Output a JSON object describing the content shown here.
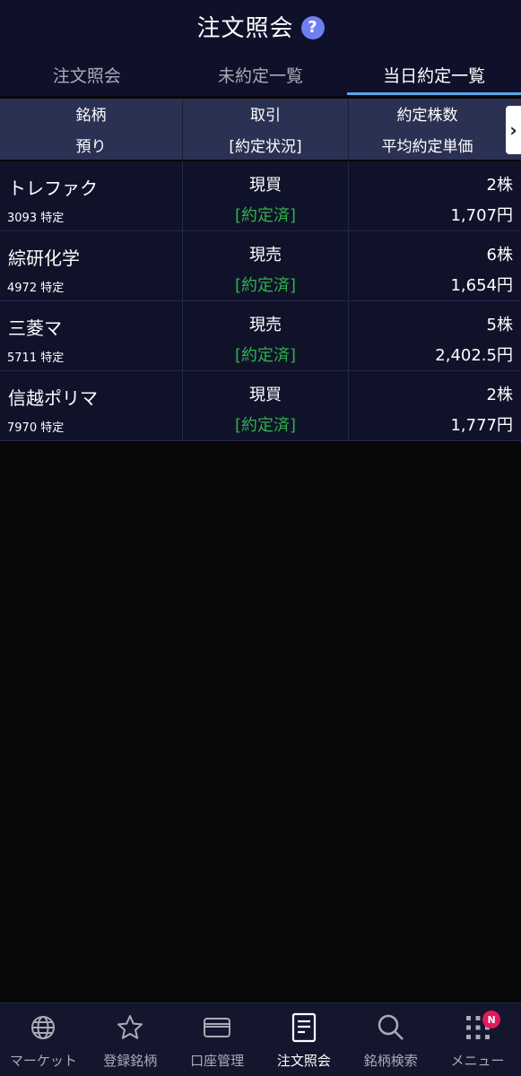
{
  "header": {
    "title": "注文照会",
    "help_icon": "question-icon"
  },
  "tabs": [
    {
      "label": "注文照会",
      "active": false
    },
    {
      "label": "未約定一覧",
      "active": false
    },
    {
      "label": "当日約定一覧",
      "active": true
    }
  ],
  "columns": {
    "c1_top": "銘柄",
    "c1_bottom": "預り",
    "c2_top": "取引",
    "c2_bottom": "[約定状況]",
    "c3_top": "約定株数",
    "c3_bottom": "平均約定単価",
    "scroll_icon": "chevron-right-icon"
  },
  "rows": [
    {
      "name": "トレファク",
      "sub": "3093 特定",
      "trade": "現買",
      "status": "[約定済]",
      "qty": "2株",
      "price": "1,707円"
    },
    {
      "name": "綜研化学",
      "sub": "4972 特定",
      "trade": "現売",
      "status": "[約定済]",
      "qty": "6株",
      "price": "1,654円"
    },
    {
      "name": "三菱マ",
      "sub": "5711 特定",
      "trade": "現売",
      "status": "[約定済]",
      "qty": "5株",
      "price": "2,402.5円"
    },
    {
      "name": "信越ポリマ",
      "sub": "7970 特定",
      "trade": "現買",
      "status": "[約定済]",
      "qty": "2株",
      "price": "1,777円"
    }
  ],
  "colors": {
    "status_green": "#2fb24a",
    "header_bg": "#0f1029",
    "column_header_bg": "#2a3152",
    "active_tab_underline": "#5aa8e8",
    "badge": "#e3195a"
  },
  "bottom_nav": [
    {
      "label": "マーケット",
      "icon": "globe-icon",
      "active": false
    },
    {
      "label": "登録銘柄",
      "icon": "star-icon",
      "active": false
    },
    {
      "label": "口座管理",
      "icon": "card-icon",
      "active": false
    },
    {
      "label": "注文照会",
      "icon": "document-icon",
      "active": true
    },
    {
      "label": "銘柄検索",
      "icon": "search-icon",
      "active": false
    },
    {
      "label": "メニュー",
      "icon": "grid-icon",
      "active": false,
      "badge": "N"
    }
  ]
}
